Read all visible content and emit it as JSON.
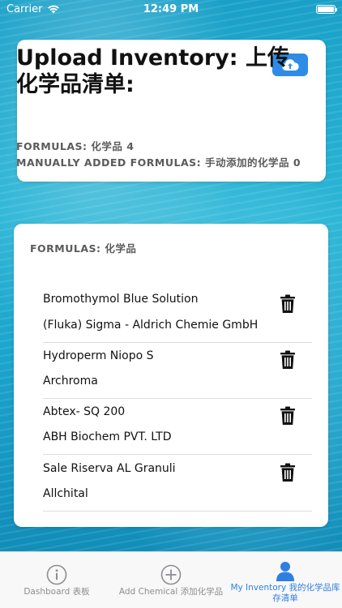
{
  "status_bar": {
    "carrier": "Carrier",
    "time": "12:49 PM"
  },
  "header": {
    "upload_icon": "cloud-upload-icon",
    "title": "Upload Inventory: 上传化学品清单:",
    "formulas_label": "FORMULAS: 化学品",
    "formulas_count": "4",
    "manual_label": "MANUALLY ADDED FORMULAS: 手动添加的化学品",
    "manual_count": "0"
  },
  "formulas_section": {
    "title": "FORMULAS: 化学品",
    "items": [
      {
        "name": "Bromothymol Blue Solution",
        "supplier": "(Fluka) Sigma - Aldrich Chemie GmbH"
      },
      {
        "name": "Hydroperm Niopo S",
        "supplier": "Archroma"
      },
      {
        "name": "Abtex- SQ 200",
        "supplier": "ABH Biochem PVT. LTD"
      },
      {
        "name": "Sale Riserva AL Granuli",
        "supplier": "Allchital"
      }
    ]
  },
  "tab_bar": {
    "tabs": [
      {
        "label": "Dashboard 表板",
        "icon": "info-circle-icon",
        "active": false
      },
      {
        "label": "Add Chemical 添加化学品",
        "icon": "plus-circle-icon",
        "active": false
      },
      {
        "label": "My Inventory 我的化学品库存清单",
        "icon": "person-icon",
        "active": true
      }
    ]
  },
  "colors": {
    "accent": "#2f8ce6",
    "active_tab": "#2f7fe0",
    "inactive_tab": "#8e8e93",
    "ocean": "#1aa0c8"
  }
}
